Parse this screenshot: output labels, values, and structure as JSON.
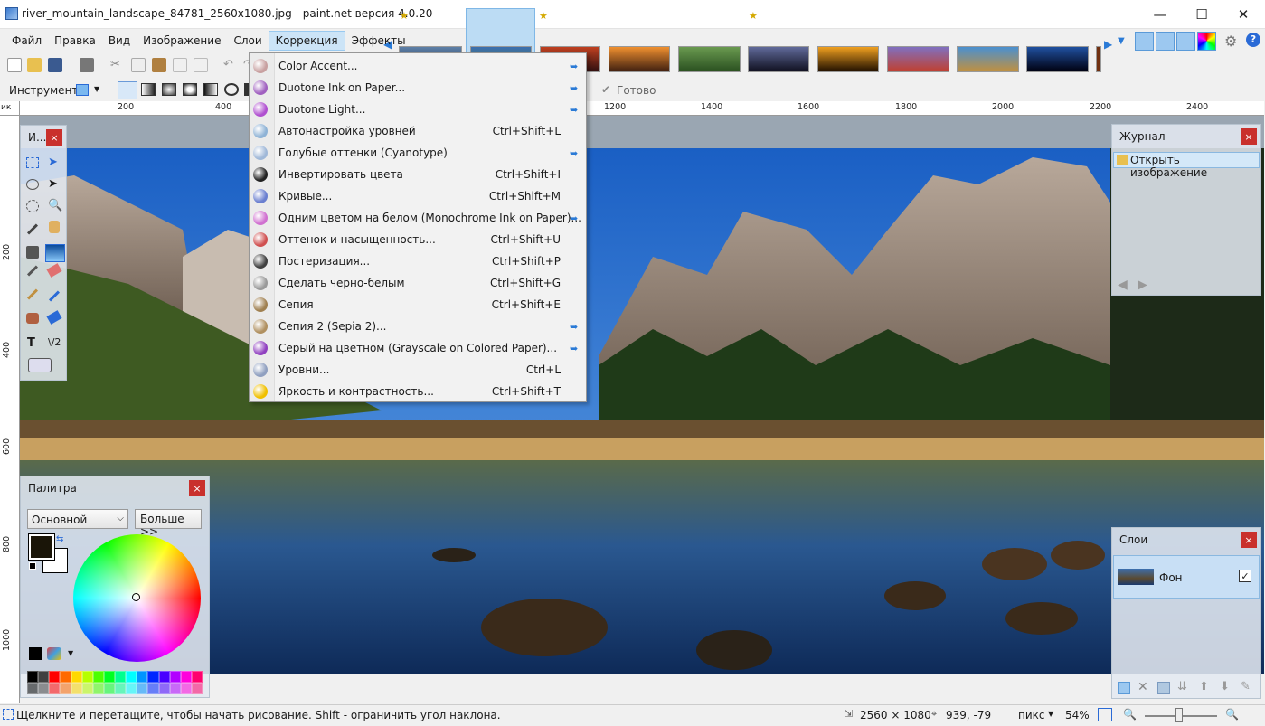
{
  "app": {
    "title": "river_mountain_landscape_84781_2560x1080.jpg - paint.net версия 4.0.20"
  },
  "menu": {
    "items": [
      "Файл",
      "Правка",
      "Вид",
      "Изображение",
      "Слои",
      "Коррекция",
      "Эффекты"
    ],
    "active": "Коррекция"
  },
  "toolbar": {
    "instrument_label": "Инструмент:",
    "status": "Готово"
  },
  "ruler": {
    "h_labels": [
      "200",
      "400",
      "1200",
      "1400",
      "1600",
      "1800",
      "2000",
      "2200",
      "2400"
    ],
    "v_labels": [
      "200",
      "400",
      "600",
      "800",
      "1000"
    ],
    "unit_abbrev": "ик"
  },
  "dropdown": {
    "items": [
      {
        "label": "Color Accent...",
        "shortcut": "",
        "plugin": true,
        "icon_color": "#c8a0a0"
      },
      {
        "label": "Duotone Ink on Paper...",
        "shortcut": "",
        "plugin": true,
        "icon_color": "#a060c0"
      },
      {
        "label": "Duotone Light...",
        "shortcut": "",
        "plugin": true,
        "icon_color": "#b050d0"
      },
      {
        "label": "Автонастройка уровней",
        "shortcut": "Ctrl+Shift+L",
        "plugin": false,
        "icon_color": "#8fb3d6"
      },
      {
        "label": "Голубые оттенки (Cyanotype)",
        "shortcut": "",
        "plugin": true,
        "icon_color": "#a0b8d8"
      },
      {
        "label": "Инвертировать цвета",
        "shortcut": "Ctrl+Shift+I",
        "plugin": false,
        "icon_color": "#222222"
      },
      {
        "label": "Кривые...",
        "shortcut": "Ctrl+Shift+M",
        "plugin": false,
        "icon_color": "#6a7fd0"
      },
      {
        "label": "Одним цветом на белом (Monochrome Ink on Paper)...",
        "shortcut": "",
        "plugin": true,
        "icon_color": "#d070d0"
      },
      {
        "label": "Оттенок и насыщенность...",
        "shortcut": "Ctrl+Shift+U",
        "plugin": false,
        "icon_color": "#d05050"
      },
      {
        "label": "Постеризация...",
        "shortcut": "Ctrl+Shift+P",
        "plugin": false,
        "icon_color": "#404040"
      },
      {
        "label": "Сделать черно-белым",
        "shortcut": "Ctrl+Shift+G",
        "plugin": false,
        "icon_color": "#9a9a9a"
      },
      {
        "label": "Сепия",
        "shortcut": "Ctrl+Shift+E",
        "plugin": false,
        "icon_color": "#a08050"
      },
      {
        "label": "Сепия 2 (Sepia 2)...",
        "shortcut": "",
        "plugin": true,
        "icon_color": "#b09060"
      },
      {
        "label": "Серый на цветном (Grayscale on Colored Paper)...",
        "shortcut": "",
        "plugin": true,
        "icon_color": "#9040c0"
      },
      {
        "label": "Уровни...",
        "shortcut": "Ctrl+L",
        "plugin": false,
        "icon_color": "#90a0c0"
      },
      {
        "label": "Яркость и контрастность...",
        "shortcut": "Ctrl+Shift+T",
        "plugin": false,
        "icon_color": "#f0c000"
      }
    ]
  },
  "panels": {
    "tools": {
      "title": "И..."
    },
    "palette": {
      "title": "Палитра",
      "mode": "Основной",
      "more_button": "Больше >>"
    },
    "history": {
      "title": "Журнал",
      "items": [
        "Открыть изображение"
      ]
    },
    "layers": {
      "title": "Слои",
      "items": [
        {
          "name": "Фон",
          "visible": true
        }
      ]
    }
  },
  "palette_colors": [
    "#000000",
    "#404040",
    "#ff0000",
    "#ff6a00",
    "#ffd800",
    "#b6ff00",
    "#4cff00",
    "#00ff21",
    "#00ff90",
    "#00ffff",
    "#0094ff",
    "#0026ff",
    "#4800ff",
    "#b200ff",
    "#ff00dc",
    "#ff006e"
  ],
  "status": {
    "hint": "Щелкните и перетащите, чтобы начать рисование. Shift - ограничить угол наклона.",
    "image_size": "2560 × 1080",
    "cursor_pos": "939, -79",
    "unit": "пикс",
    "zoom": "54%"
  },
  "colors": {
    "accent": "#0078d7",
    "close_red": "#c9302c"
  }
}
